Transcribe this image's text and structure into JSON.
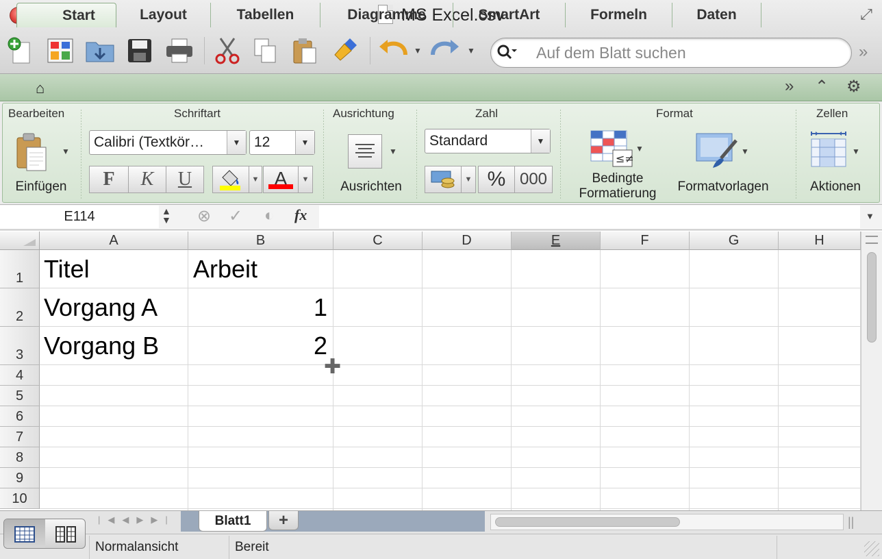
{
  "window": {
    "title": "MS Excel.csv"
  },
  "toolbar": {
    "search_placeholder": "Auf dem Blatt suchen",
    "icons": [
      "new-workbook-icon",
      "templates-icon",
      "open-icon",
      "save-icon",
      "print-icon",
      "cut-icon",
      "copy-icon",
      "paste-icon",
      "format-painter-icon",
      "undo-icon",
      "redo-icon"
    ]
  },
  "ribbon_tabs": [
    "Start",
    "Layout",
    "Tabellen",
    "Diagramme",
    "SmartArt",
    "Formeln",
    "Daten"
  ],
  "ribbon": {
    "groups": {
      "bearbeiten": "Bearbeiten",
      "schriftart": "Schriftart",
      "ausrichtung": "Ausrichtung",
      "zahl": "Zahl",
      "format": "Format",
      "zellen": "Zellen"
    },
    "paste_label": "Einfügen",
    "font_name": "Calibri (Textkör…",
    "font_size": "12",
    "bold": "F",
    "italic": "K",
    "underline": "U",
    "font_color_letter": "A",
    "align_label": "Ausrichten",
    "number_format": "Standard",
    "percent": "%",
    "thousands": "000",
    "cond_format_label_1": "Bedingte",
    "cond_format_label_2": "Formatierung",
    "styles_label": "Formatvorlagen",
    "actions_label": "Aktionen",
    "colors": {
      "highlight": "#ffff00",
      "font": "#ff0000"
    }
  },
  "formula_bar": {
    "name_box": "E114",
    "formula": ""
  },
  "grid": {
    "columns": [
      "A",
      "B",
      "C",
      "D",
      "E",
      "F",
      "G",
      "H"
    ],
    "selected_column": "E",
    "rows": [
      "1",
      "2",
      "3",
      "4",
      "5",
      "6",
      "7",
      "8",
      "9",
      "10"
    ],
    "cells": {
      "A1": "Titel",
      "B1": "Arbeit",
      "A2": "Vorgang A",
      "B2": "1",
      "A3": "Vorgang B",
      "B3": "2"
    }
  },
  "sheets": {
    "active": "Blatt1",
    "add": "+"
  },
  "status": {
    "view": "Normalansicht",
    "state": "Bereit"
  }
}
